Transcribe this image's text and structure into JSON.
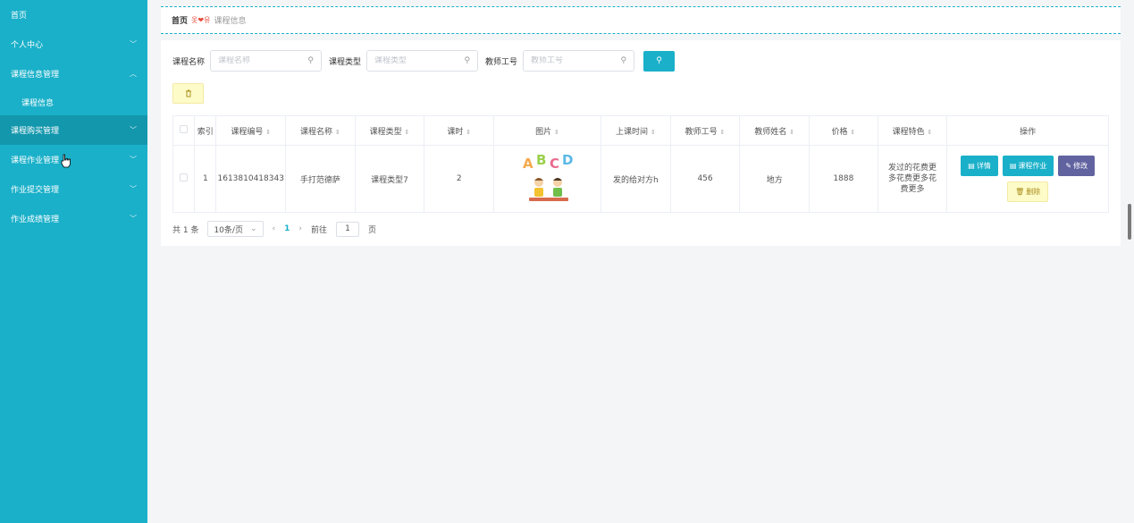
{
  "sidebar": {
    "items": [
      {
        "label": "首页",
        "has_chevron": false
      },
      {
        "label": "个人中心",
        "has_chevron": true,
        "chevron": "﹀"
      },
      {
        "label": "课程信息管理",
        "has_chevron": true,
        "chevron": "︿"
      },
      {
        "label": "课程信息",
        "sub": true
      },
      {
        "label": "课程购买管理",
        "has_chevron": true,
        "chevron": "﹀",
        "active": true
      },
      {
        "label": "课程作业管理",
        "has_chevron": true,
        "chevron": "﹀"
      },
      {
        "label": "作业提交管理",
        "has_chevron": true,
        "chevron": "﹀"
      },
      {
        "label": "作业成绩管理",
        "has_chevron": true,
        "chevron": "﹀"
      }
    ]
  },
  "breadcrumb": {
    "home": "首页",
    "separator": "옷❤유",
    "current": "课程信息"
  },
  "search": {
    "fields": [
      {
        "label": "课程名称",
        "placeholder": "课程名称"
      },
      {
        "label": "课程类型",
        "placeholder": "课程类型"
      },
      {
        "label": "教师工号",
        "placeholder": "教师工号"
      }
    ]
  },
  "table": {
    "columns": [
      "索引",
      "课程编号",
      "课程名称",
      "课程类型",
      "课时",
      "图片",
      "上课时间",
      "教师工号",
      "教师姓名",
      "价格",
      "课程特色",
      "操作"
    ],
    "rows": [
      {
        "index": "1",
        "course_no": "1613810418343",
        "course_name": "手打范德萨",
        "course_type": "课程类型7",
        "hours": "2",
        "image_text": "ABCD",
        "class_time": "发的给对方h",
        "teacher_no": "456",
        "teacher_name": "地方",
        "price": "1888",
        "feature": "发过的花费更多花费更多花费更多"
      }
    ],
    "actions": {
      "detail": "详情",
      "homework": "课程作业",
      "edit": "修改",
      "delete": "删除"
    }
  },
  "pager": {
    "total": "共 1 条",
    "page_size": "10条/页",
    "current_page": "1",
    "goto_label": "前往",
    "goto_value": "1",
    "page_suffix": "页"
  },
  "colors": {
    "sidebar": "#1ab0c9",
    "sidebar_active": "#1397ad",
    "primary": "#1ab0c9",
    "edit": "#6163a0",
    "delete_bg": "#fdfcc8"
  }
}
